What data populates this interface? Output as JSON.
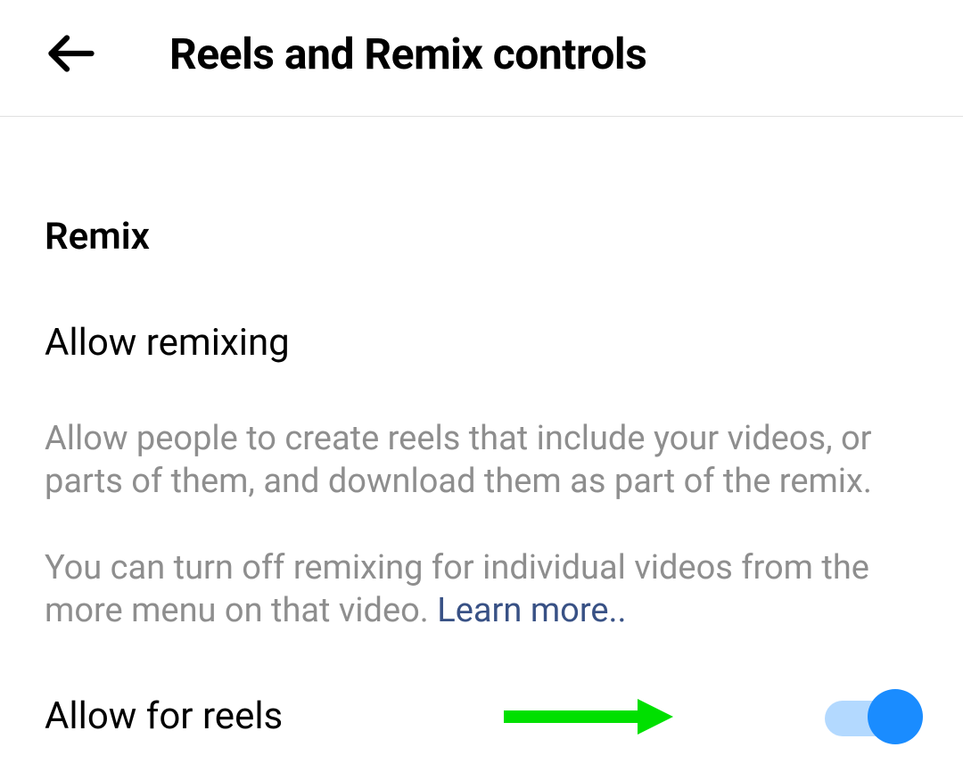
{
  "header": {
    "title": "Reels and Remix controls"
  },
  "remix": {
    "section_heading": "Remix",
    "setting_heading": "Allow remixing",
    "description1": "Allow people to create reels that include your videos, or parts of them, and download them as part of the remix.",
    "description2_prefix": "You can turn off remixing for individual videos from the more menu on that video. ",
    "learn_more": "Learn more..",
    "toggle": {
      "label": "Allow for reels",
      "on": true
    }
  },
  "colors": {
    "toggle_on": "#1a8cff",
    "toggle_track": "#b3d9ff",
    "link": "#385185",
    "muted": "#8e8e8e",
    "annotation": "#00e000"
  }
}
